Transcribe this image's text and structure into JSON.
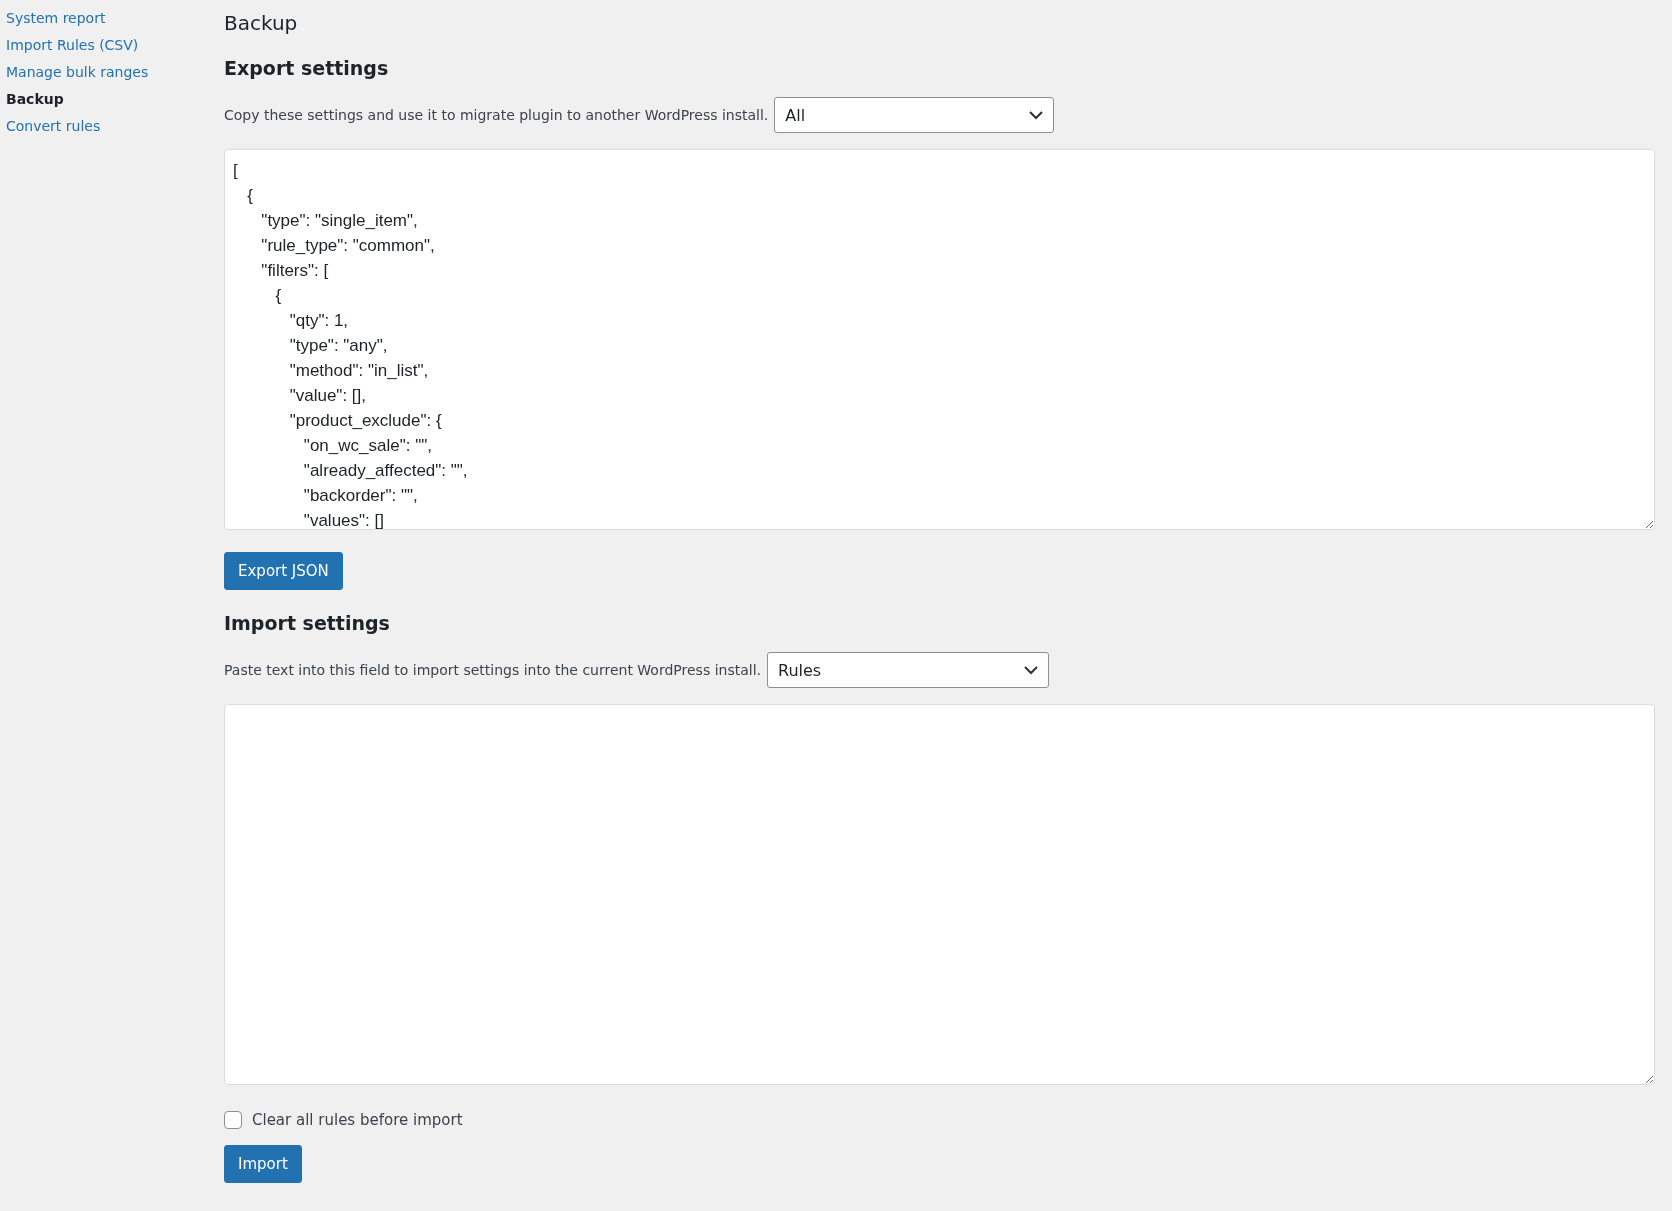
{
  "sidebar": {
    "items": [
      {
        "label": "System report",
        "selected": false
      },
      {
        "label": "Import Rules (CSV)",
        "selected": false
      },
      {
        "label": "Manage bulk ranges",
        "selected": false
      },
      {
        "label": "Backup",
        "selected": true
      },
      {
        "label": "Convert rules",
        "selected": false
      }
    ]
  },
  "page_title": "Backup",
  "export": {
    "heading": "Export settings",
    "description": "Copy these settings and use it to migrate plugin to another WordPress install.",
    "select_value": "All",
    "code": "[\n\t{\n\t\t\"type\": \"single_item\",\n\t\t\"rule_type\": \"common\",\n\t\t\"filters\": [\n\t\t\t{\n\t\t\t\t\"qty\": 1,\n\t\t\t\t\"type\": \"any\",\n\t\t\t\t\"method\": \"in_list\",\n\t\t\t\t\"value\": [],\n\t\t\t\t\"product_exclude\": {\n\t\t\t\t\t\"on_wc_sale\": \"\",\n\t\t\t\t\t\"already_affected\": \"\",\n\t\t\t\t\t\"backorder\": \"\",\n\t\t\t\t\t\"values\": []",
    "button": "Export JSON"
  },
  "import": {
    "heading": "Import settings",
    "description": "Paste text into this field to import settings into the current WordPress install.",
    "select_value": "Rules",
    "checkbox": {
      "label": "Clear all rules before import",
      "checked": false
    },
    "button": "Import"
  }
}
